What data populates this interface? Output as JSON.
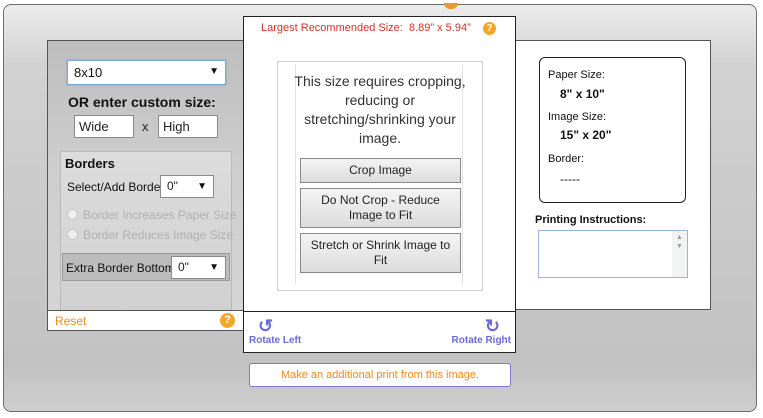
{
  "largest_size": {
    "label": "Largest Recommended Size:",
    "value": "8.89” x 5.94”"
  },
  "left": {
    "size_select_value": "8x10",
    "custom_size_label": "OR  enter custom size:",
    "wide_value": "Wide",
    "x_label": "x",
    "high_value": "High",
    "borders": {
      "title": "Borders",
      "select_label": "Select/Add Border:",
      "select_value": "0\"",
      "option_increase": "Border Increases Paper Size",
      "option_reduce": "Border Reduces Image Size",
      "extra_label": "Extra Border Bottom:",
      "extra_value": "0\""
    },
    "reset_label": "Reset",
    "help_glyph": "?"
  },
  "center": {
    "message": "This size requires cropping, reducing or stretching/shrinking your image.",
    "crop_button": "Crop Image",
    "no_crop_button": "Do Not Crop - Reduce Image to Fit",
    "stretch_button": "Stretch or Shrink Image to Fit",
    "rotate_left": "Rotate Left",
    "rotate_right": "Rotate Right",
    "help_glyph": "?"
  },
  "right": {
    "paper_size_label": "Paper Size:",
    "paper_size_value": "8\" x 10\"",
    "image_size_label": "Image Size:",
    "image_size_value": "15\" x 20\"",
    "border_label": "Border:",
    "border_value": "-----",
    "printing_instructions_label": "Printing Instructions:"
  },
  "additional_print_button": "Make an additional print from this image.",
  "icons": {
    "dropdown": "chevron-down-icon",
    "help": "help-icon",
    "rotate_left": "rotate-left-icon",
    "rotate_right": "rotate-right-icon"
  },
  "colors": {
    "accent_orange": "#f08a1d",
    "warning_red": "#d4302a",
    "rotate_blue": "#6b6bd6"
  }
}
